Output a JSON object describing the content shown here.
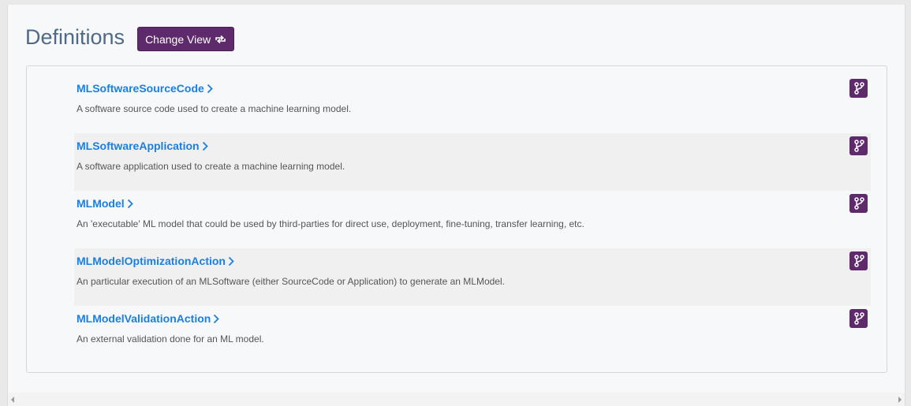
{
  "header": {
    "title": "Definitions",
    "change_view_label": "Change View",
    "change_view_icon": "refresh-icon"
  },
  "definitions": [
    {
      "name": "MLSoftwareSourceCode",
      "description": "A software source code used to create a machine learning model."
    },
    {
      "name": "MLSoftwareApplication",
      "description": "A software application used to create a machine learning model."
    },
    {
      "name": "MLModel",
      "description": "An 'executable' ML model that could be used by third-parties for direct use, deployment, fine-tuning, transfer learning, etc."
    },
    {
      "name": "MLModelOptimizationAction",
      "description": "An particular execution of an MLSoftware (either SourceCode or Application) to generate an MLModel."
    },
    {
      "name": "MLModelValidationAction",
      "description": "An external validation done for an ML model."
    }
  ],
  "icons": {
    "row_link": "chevron-right-icon",
    "row_action": "branch-icon"
  },
  "colors": {
    "accent": "#5e2a6b",
    "link": "#1a7fe0",
    "title": "#4e6a86"
  }
}
